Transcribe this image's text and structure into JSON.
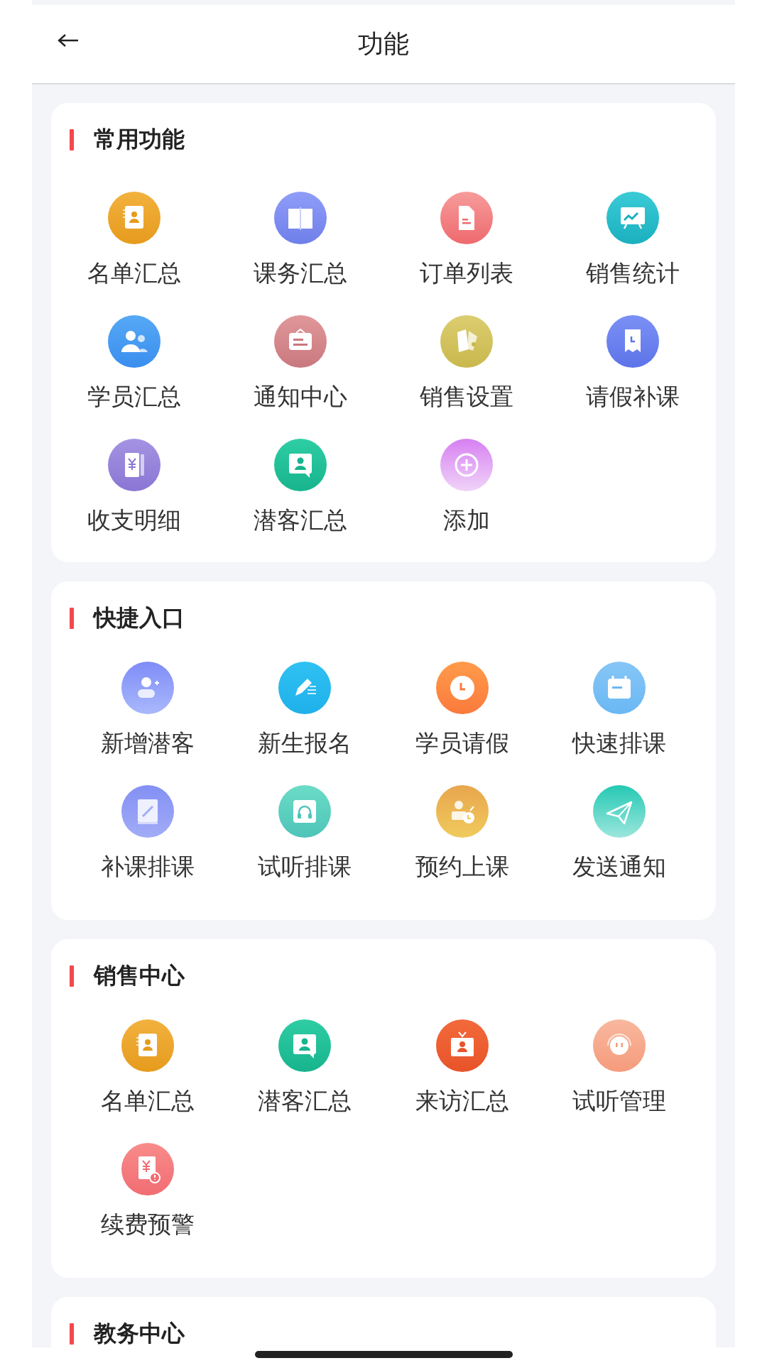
{
  "header": {
    "title": "功能"
  },
  "sections": [
    {
      "title": "常用功能",
      "items": [
        {
          "label": "名单汇总"
        },
        {
          "label": "课务汇总"
        },
        {
          "label": "订单列表"
        },
        {
          "label": "销售统计"
        },
        {
          "label": "学员汇总"
        },
        {
          "label": "通知中心"
        },
        {
          "label": "销售设置"
        },
        {
          "label": "请假补课"
        },
        {
          "label": "收支明细"
        },
        {
          "label": "潜客汇总"
        },
        {
          "label": "添加"
        }
      ]
    },
    {
      "title": "快捷入口",
      "items": [
        {
          "label": "新增潜客"
        },
        {
          "label": "新生报名"
        },
        {
          "label": "学员请假"
        },
        {
          "label": "快速排课"
        },
        {
          "label": "补课排课"
        },
        {
          "label": "试听排课"
        },
        {
          "label": "预约上课"
        },
        {
          "label": "发送通知"
        }
      ]
    },
    {
      "title": "销售中心",
      "items": [
        {
          "label": "名单汇总"
        },
        {
          "label": "潜客汇总"
        },
        {
          "label": "来访汇总"
        },
        {
          "label": "试听管理"
        },
        {
          "label": "续费预警"
        }
      ]
    },
    {
      "title": "教务中心"
    }
  ]
}
